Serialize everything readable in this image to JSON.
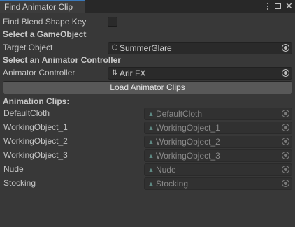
{
  "window": {
    "tab_title": "Find Animator Clip",
    "icons": [
      "kebab-menu-icon",
      "maximize-icon",
      "close-icon"
    ]
  },
  "blend_shape": {
    "label": "Find Blend Shape Key",
    "checked": false
  },
  "gameobject_section": {
    "heading": "Select a GameObject",
    "field_label": "Target Object",
    "value": "SummerGlare",
    "icon": "gameobject-cube-icon"
  },
  "controller_section": {
    "heading": "Select an Animator Controller",
    "field_label": "Animator Controller",
    "value": "Arir FX",
    "icon": "animator-controller-icon"
  },
  "load_button": {
    "label": "Load Animator Clips"
  },
  "clips_section": {
    "heading": "Animation Clips:",
    "items": [
      {
        "name": "DefaultCloth",
        "value": "DefaultCloth"
      },
      {
        "name": "WorkingObject_1",
        "value": "WorkingObject_1"
      },
      {
        "name": "WorkingObject_2",
        "value": "WorkingObject_2"
      },
      {
        "name": "WorkingObject_3",
        "value": "WorkingObject_3"
      },
      {
        "name": "Nude",
        "value": "Nude"
      },
      {
        "name": "Stocking",
        "value": "Stocking"
      }
    ],
    "item_icon": "animation-clip-icon"
  },
  "colors": {
    "background": "#383838",
    "tab_accent": "#3a79bb",
    "field_bg": "#2a2a2a",
    "button_bg": "#585858"
  }
}
